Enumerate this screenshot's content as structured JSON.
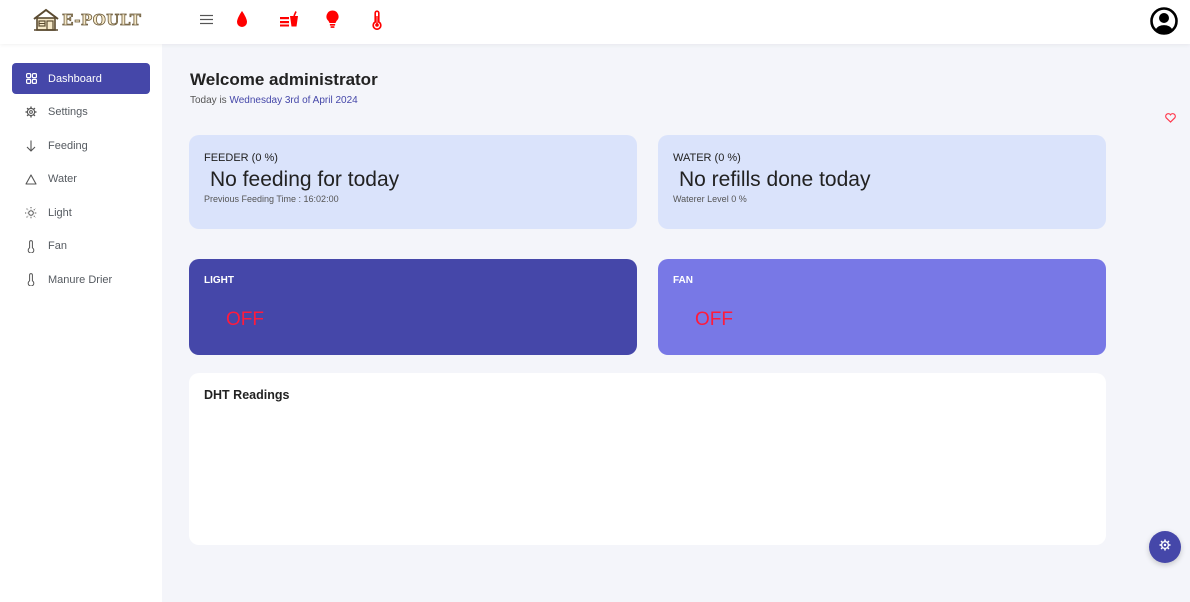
{
  "brand": {
    "name": "E-POULT"
  },
  "topbar": {
    "icons": [
      "menu-icon",
      "water-drop-icon",
      "feeder-icon",
      "light-bulb-icon",
      "thermometer-icon",
      "avatar-icon"
    ],
    "accent_color": "#ff0000"
  },
  "sidebar": {
    "items": [
      {
        "label": "Dashboard",
        "icon": "dashboard-grid-icon",
        "active": true
      },
      {
        "label": "Settings",
        "icon": "gear-icon"
      },
      {
        "label": "Feeding",
        "icon": "arrow-down-icon"
      },
      {
        "label": "Water",
        "icon": "drop-outline-icon"
      },
      {
        "label": "Light",
        "icon": "sun-icon"
      },
      {
        "label": "Fan",
        "icon": "thermometer-icon"
      },
      {
        "label": "Manure Drier",
        "icon": "thermometer-icon"
      }
    ]
  },
  "header": {
    "welcome": "Welcome administrator",
    "today_prefix": "Today is ",
    "today_date": "Wednesday 3rd of April 2024"
  },
  "cards": {
    "feeder": {
      "label": "FEEDER (0 %)",
      "status": "No feeding for today",
      "sub": "Previous Feeding Time : 16:02:00"
    },
    "water": {
      "label": "WATER (0 %)",
      "status": "No refills done today",
      "sub": "Waterer Level 0 %"
    },
    "light": {
      "label": "LIGHT",
      "value": "OFF",
      "color": "#4547a9"
    },
    "fan": {
      "label": "FAN",
      "value": "OFF",
      "color": "#7878e6"
    }
  },
  "dht": {
    "title": "DHT Readings"
  },
  "colors": {
    "primary": "#4547a9",
    "off_text": "#ff1a3c",
    "info_card": "#dae3fb"
  }
}
